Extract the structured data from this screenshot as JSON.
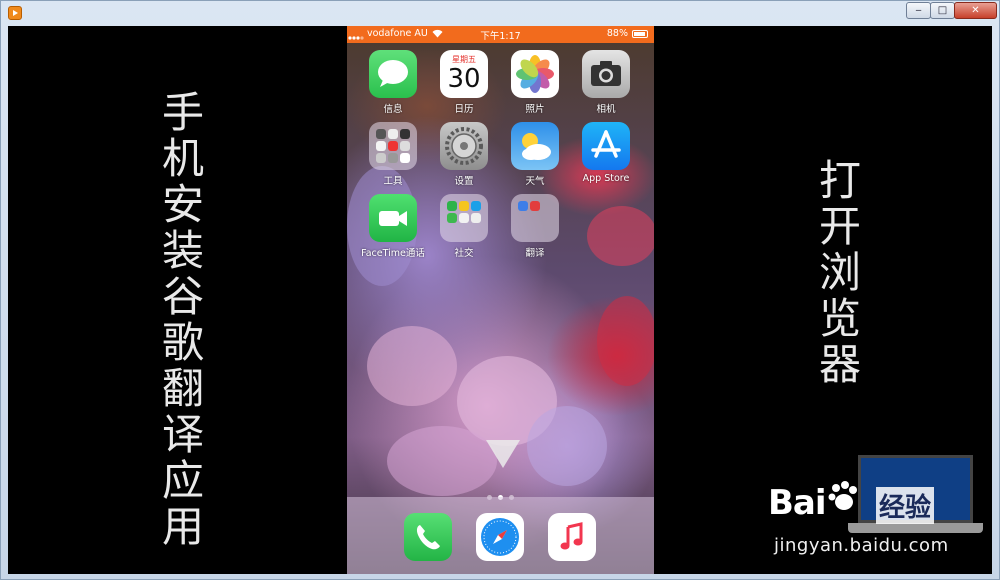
{
  "window": {
    "controls": {
      "minimize": "‒",
      "maximize": "□",
      "close": "✕"
    }
  },
  "left_caption": [
    "手",
    "机",
    "安",
    "装",
    "谷",
    "歌",
    "翻",
    "译",
    "应",
    "用"
  ],
  "right_caption": [
    "打",
    "开",
    "浏",
    "览",
    "器"
  ],
  "phone": {
    "status": {
      "carrier": "vodafone AU",
      "time": "下午1:17",
      "battery": "88%"
    },
    "calendar": {
      "weekday": "星期五",
      "day": "30"
    },
    "apps": [
      {
        "label": "信息"
      },
      {
        "label": "日历"
      },
      {
        "label": "照片"
      },
      {
        "label": "相机"
      },
      {
        "label": "工具"
      },
      {
        "label": "设置"
      },
      {
        "label": "天气"
      },
      {
        "label": "App Store"
      },
      {
        "label": "FaceTime通话"
      },
      {
        "label": "社交"
      },
      {
        "label": "翻译"
      }
    ],
    "dock": [
      "phone-app",
      "safari-app",
      "music-app"
    ]
  },
  "watermark": {
    "brand": "Bai",
    "brand_cn": "经验",
    "url": "jingyan.baidu.com"
  },
  "colors": {
    "status_bar": "#f26b1d",
    "content_bg": "#000000",
    "messages": "#35c759",
    "facetime": "#2fb84e"
  }
}
